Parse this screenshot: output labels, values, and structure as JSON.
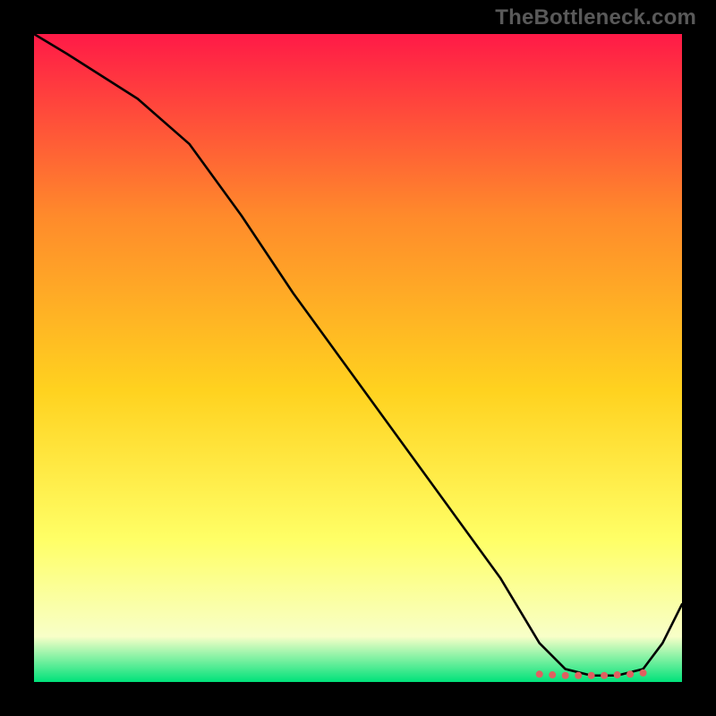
{
  "watermark": "TheBottleneck.com",
  "gradient": {
    "top_color": "#ff1a47",
    "upper_mid_color": "#ff8a2b",
    "mid_color": "#ffd21f",
    "lower_mid_color": "#ffff66",
    "near_bottom_color": "#f8ffc8",
    "bottom_color": "#00e27a"
  },
  "chart_data": {
    "type": "line",
    "title": "",
    "xlabel": "",
    "ylabel": "",
    "xlim": [
      0,
      100
    ],
    "ylim": [
      0,
      100
    ],
    "series": [
      {
        "name": "curve",
        "x": [
          0,
          5,
          16,
          24,
          32,
          40,
          48,
          56,
          64,
          72,
          78,
          82,
          86,
          90,
          94,
          97,
          100
        ],
        "values": [
          100,
          97,
          90,
          83,
          72,
          60,
          49,
          38,
          27,
          16,
          6,
          2,
          1,
          1,
          2,
          6,
          12
        ]
      }
    ],
    "markers": {
      "name": "dots",
      "x": [
        78,
        80,
        82,
        84,
        86,
        88,
        90,
        92,
        94
      ],
      "values": [
        1.2,
        1.1,
        1.0,
        1.0,
        1.0,
        1.0,
        1.1,
        1.2,
        1.4
      ],
      "color": "#e06060",
      "radius_px": 4
    }
  }
}
